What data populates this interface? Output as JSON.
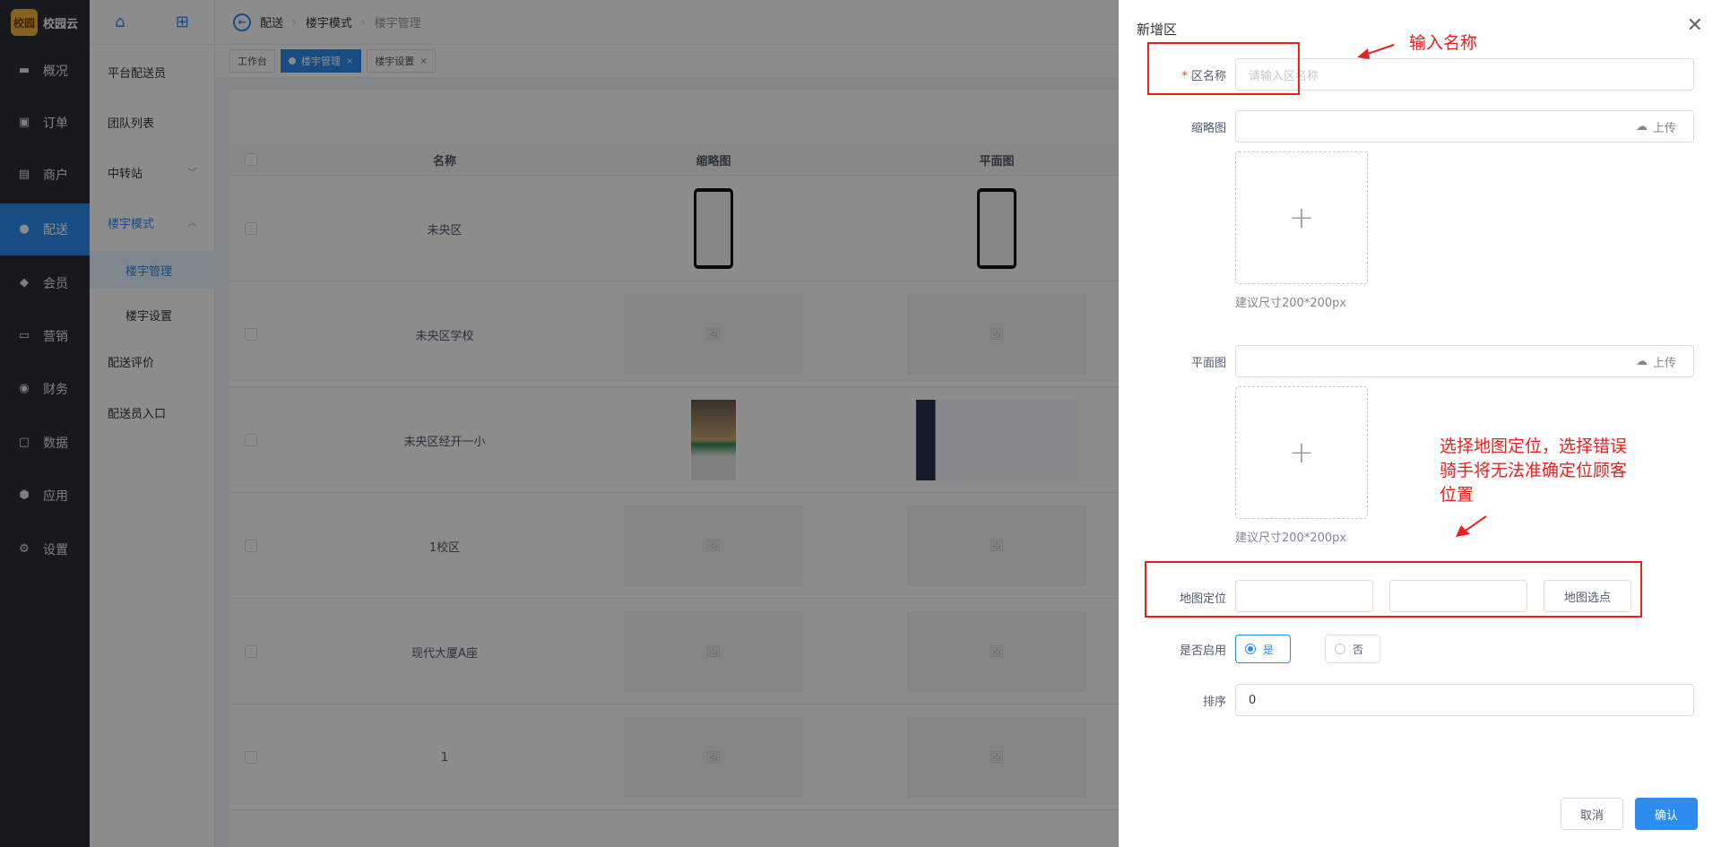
{
  "app": {
    "logo_badge": "校园",
    "logo_name": "校园云"
  },
  "nav": [
    {
      "label": "概况",
      "icon": "monitor-icon"
    },
    {
      "label": "订单",
      "icon": "cart-icon"
    },
    {
      "label": "商户",
      "icon": "store-icon"
    },
    {
      "label": "配送",
      "icon": "user-icon"
    },
    {
      "label": "会员",
      "icon": "diamond-icon"
    },
    {
      "label": "营销",
      "icon": "ticket-icon"
    },
    {
      "label": "财务",
      "icon": "money-bag-icon"
    },
    {
      "label": "数据",
      "icon": "screen-chart-icon"
    },
    {
      "label": "应用",
      "icon": "cube-icon"
    },
    {
      "label": "设置",
      "icon": "gear-icon"
    }
  ],
  "subnav": [
    {
      "label": "平台配送员"
    },
    {
      "label": "团队列表"
    },
    {
      "label": "中转站"
    },
    {
      "label": "楼宇模式"
    },
    {
      "label": "楼宇管理"
    },
    {
      "label": "楼宇设置"
    },
    {
      "label": "配送评价"
    },
    {
      "label": "配送员入口"
    }
  ],
  "breadcrumb": [
    "配送",
    "楼宇模式",
    "楼宇管理"
  ],
  "tabs": [
    {
      "label": "工作台"
    },
    {
      "label": "楼宇管理"
    },
    {
      "label": "楼宇设置"
    }
  ],
  "table": {
    "headers": [
      "名称",
      "缩略图",
      "平面图"
    ],
    "rows": [
      {
        "name": "未央区"
      },
      {
        "name": "未央区学校"
      },
      {
        "name": "未央区经开一小"
      },
      {
        "name": "1校区"
      },
      {
        "name": "现代大厦A座"
      },
      {
        "name": "1"
      }
    ]
  },
  "drawer": {
    "title": "新增区",
    "name_label": "区名称",
    "name_placeholder": "请输入区名称",
    "thumb_label": "缩略图",
    "upload_label": "上传",
    "thumb_hint": "建议尺寸200*200px",
    "plan_label": "平面图",
    "plan_hint": "建议尺寸200*200px",
    "map_label": "地图定位",
    "map_button": "地图选点",
    "enable_label": "是否启用",
    "enable_yes": "是",
    "enable_no": "否",
    "sort_label": "排序",
    "sort_value": "0",
    "cancel": "取消",
    "confirm": "确认"
  },
  "annotations": {
    "name_note": "输入名称",
    "map_note_1": "选择地图定位，选择错误",
    "map_note_2": "骑手将无法准确定位顾客",
    "map_note_3": "位置"
  },
  "colors": {
    "primary": "#2d8cf0",
    "sidebar": "#2b2f3a",
    "annotation": "#f01d1d"
  }
}
